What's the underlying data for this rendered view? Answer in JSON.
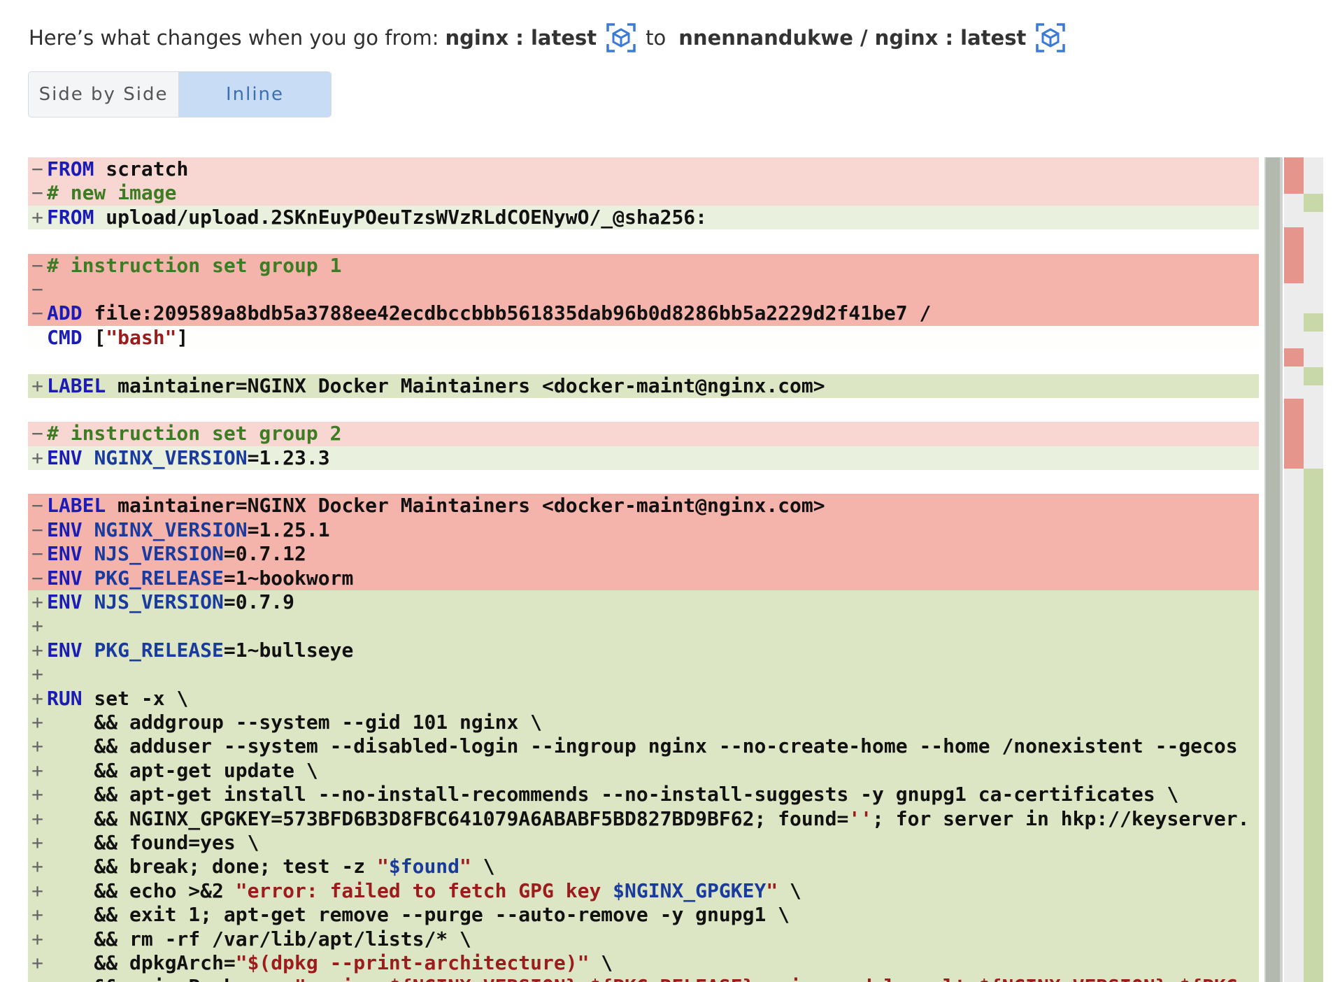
{
  "header": {
    "intro": "Here’s what changes when you go from:",
    "from_image": "nginx : latest",
    "connector": "to",
    "to_image": "nnennandukwe / nginx : latest"
  },
  "view_toggle": {
    "side_by_side": "Side by Side",
    "inline": "Inline",
    "selected": "Inline"
  },
  "colors": {
    "removed": "#f4b4ab",
    "added": "#dde6c4",
    "keyword": "#1b1bb6",
    "comment": "#3c7d24",
    "string": "#9b1c1c",
    "accent": "#3b6fb3"
  },
  "diff_lines": [
    {
      "type": "del-light",
      "marker": "−",
      "segments": [
        {
          "cls": "kw",
          "text": "FROM"
        },
        {
          "cls": "",
          "text": " scratch"
        }
      ]
    },
    {
      "type": "del-light",
      "marker": "−",
      "segments": [
        {
          "cls": "cm",
          "text": "# new image"
        }
      ]
    },
    {
      "type": "add-light",
      "marker": "+",
      "segments": [
        {
          "cls": "kw",
          "text": "FROM"
        },
        {
          "cls": "",
          "text": " upload/upload.2SKnEuyPOeuTzsWVzRLdCOENywO/_@sha256:"
        }
      ]
    },
    {
      "type": "blank",
      "marker": "",
      "segments": []
    },
    {
      "type": "del",
      "marker": "−",
      "segments": [
        {
          "cls": "cm",
          "text": "# instruction set group 1"
        }
      ]
    },
    {
      "type": "del",
      "marker": "−",
      "segments": []
    },
    {
      "type": "del",
      "marker": "−",
      "segments": [
        {
          "cls": "kw",
          "text": "ADD"
        },
        {
          "cls": "",
          "text": " file:209589a8bdb5a3788ee42ecdbccbbb561835dab96b0d8286bb5a2229d2f41be7 /"
        }
      ]
    },
    {
      "type": "ctx",
      "marker": " ",
      "segments": [
        {
          "cls": "kw",
          "text": "CMD"
        },
        {
          "cls": "",
          "text": " ["
        },
        {
          "cls": "st",
          "text": "\"bash\""
        },
        {
          "cls": "",
          "text": "]"
        }
      ]
    },
    {
      "type": "blank",
      "marker": "",
      "segments": []
    },
    {
      "type": "add",
      "marker": "+",
      "segments": [
        {
          "cls": "kw",
          "text": "LABEL"
        },
        {
          "cls": "",
          "text": " maintainer=NGINX Docker Maintainers <docker-maint@nginx.com>"
        }
      ]
    },
    {
      "type": "blank",
      "marker": "",
      "segments": []
    },
    {
      "type": "del-light",
      "marker": "−",
      "segments": [
        {
          "cls": "cm",
          "text": "# instruction set group 2"
        }
      ]
    },
    {
      "type": "add-light",
      "marker": "+",
      "segments": [
        {
          "cls": "kw",
          "text": "ENV"
        },
        {
          "cls": "",
          "text": " "
        },
        {
          "cls": "vr",
          "text": "NGINX_VERSION"
        },
        {
          "cls": "",
          "text": "=1.23.3"
        }
      ]
    },
    {
      "type": "blank",
      "marker": "",
      "segments": []
    },
    {
      "type": "del",
      "marker": "−",
      "segments": [
        {
          "cls": "kw",
          "text": "LABEL"
        },
        {
          "cls": "",
          "text": " maintainer=NGINX Docker Maintainers <docker-maint@nginx.com>"
        }
      ]
    },
    {
      "type": "del",
      "marker": "−",
      "segments": [
        {
          "cls": "kw",
          "text": "ENV"
        },
        {
          "cls": "",
          "text": " "
        },
        {
          "cls": "vr",
          "text": "NGINX_VERSION"
        },
        {
          "cls": "",
          "text": "=1.25.1"
        }
      ]
    },
    {
      "type": "del",
      "marker": "−",
      "segments": [
        {
          "cls": "kw",
          "text": "ENV"
        },
        {
          "cls": "",
          "text": " "
        },
        {
          "cls": "vr",
          "text": "NJS_VERSION"
        },
        {
          "cls": "",
          "text": "=0.7.12"
        }
      ]
    },
    {
      "type": "del",
      "marker": "−",
      "segments": [
        {
          "cls": "kw",
          "text": "ENV"
        },
        {
          "cls": "",
          "text": " "
        },
        {
          "cls": "vr",
          "text": "PKG_RELEASE"
        },
        {
          "cls": "",
          "text": "=1~bookworm"
        }
      ]
    },
    {
      "type": "add",
      "marker": "+",
      "segments": [
        {
          "cls": "kw",
          "text": "ENV"
        },
        {
          "cls": "",
          "text": " "
        },
        {
          "cls": "vr",
          "text": "NJS_VERSION"
        },
        {
          "cls": "",
          "text": "=0.7.9"
        }
      ]
    },
    {
      "type": "add",
      "marker": "+",
      "segments": []
    },
    {
      "type": "add",
      "marker": "+",
      "segments": [
        {
          "cls": "kw",
          "text": "ENV"
        },
        {
          "cls": "",
          "text": " "
        },
        {
          "cls": "vr",
          "text": "PKG_RELEASE"
        },
        {
          "cls": "",
          "text": "=1~bullseye"
        }
      ]
    },
    {
      "type": "add",
      "marker": "+",
      "segments": []
    },
    {
      "type": "add",
      "marker": "+",
      "segments": [
        {
          "cls": "kw",
          "text": "RUN"
        },
        {
          "cls": "",
          "text": " set -x \\"
        }
      ]
    },
    {
      "type": "add",
      "marker": "+",
      "segments": [
        {
          "cls": "",
          "text": "    && addgroup --system --gid 101 nginx \\"
        }
      ]
    },
    {
      "type": "add",
      "marker": "+",
      "segments": [
        {
          "cls": "",
          "text": "    && adduser --system --disabled-login --ingroup nginx --no-create-home --home /nonexistent --gecos"
        }
      ]
    },
    {
      "type": "add",
      "marker": "+",
      "segments": [
        {
          "cls": "",
          "text": "    && apt-get update \\"
        }
      ]
    },
    {
      "type": "add",
      "marker": "+",
      "segments": [
        {
          "cls": "",
          "text": "    && apt-get install --no-install-recommends --no-install-suggests -y gnupg1 ca-certificates \\"
        }
      ]
    },
    {
      "type": "add",
      "marker": "+",
      "segments": [
        {
          "cls": "",
          "text": "    && NGINX_GPGKEY=573BFD6B3D8FBC641079A6ABABF5BD827BD9BF62; found="
        },
        {
          "cls": "st",
          "text": "''"
        },
        {
          "cls": "",
          "text": "; for server in hkp://keyserver."
        }
      ]
    },
    {
      "type": "add",
      "marker": "+",
      "segments": [
        {
          "cls": "",
          "text": "    && found=yes \\"
        }
      ]
    },
    {
      "type": "add",
      "marker": "+",
      "segments": [
        {
          "cls": "",
          "text": "    && break; done; test -z "
        },
        {
          "cls": "st",
          "text": "\""
        },
        {
          "cls": "vr",
          "text": "$found"
        },
        {
          "cls": "st",
          "text": "\""
        },
        {
          "cls": "",
          "text": " \\"
        }
      ]
    },
    {
      "type": "add",
      "marker": "+",
      "segments": [
        {
          "cls": "",
          "text": "    && echo >&2 "
        },
        {
          "cls": "st",
          "text": "\"error: failed to fetch GPG key "
        },
        {
          "cls": "vr",
          "text": "$NGINX_GPGKEY"
        },
        {
          "cls": "st",
          "text": "\""
        },
        {
          "cls": "",
          "text": " \\"
        }
      ]
    },
    {
      "type": "add",
      "marker": "+",
      "segments": [
        {
          "cls": "",
          "text": "    && exit 1; apt-get remove --purge --auto-remove -y gnupg1 \\"
        }
      ]
    },
    {
      "type": "add",
      "marker": "+",
      "segments": [
        {
          "cls": "",
          "text": "    && rm -rf /var/lib/apt/lists/* \\"
        }
      ]
    },
    {
      "type": "add",
      "marker": "+",
      "segments": [
        {
          "cls": "",
          "text": "    && dpkgArch="
        },
        {
          "cls": "st",
          "text": "\"$(dpkg --print-architecture)\""
        },
        {
          "cls": "",
          "text": " \\"
        }
      ]
    },
    {
      "type": "add",
      "marker": "+",
      "segments": [
        {
          "cls": "",
          "text": "    && nginxPackages="
        },
        {
          "cls": "st",
          "text": "\" nginx=${NGINX_VERSION}-${PKG_RELEASE} nginx-module-xslt=${NGINX_VERSION}-${PKG"
        }
      ]
    }
  ]
}
